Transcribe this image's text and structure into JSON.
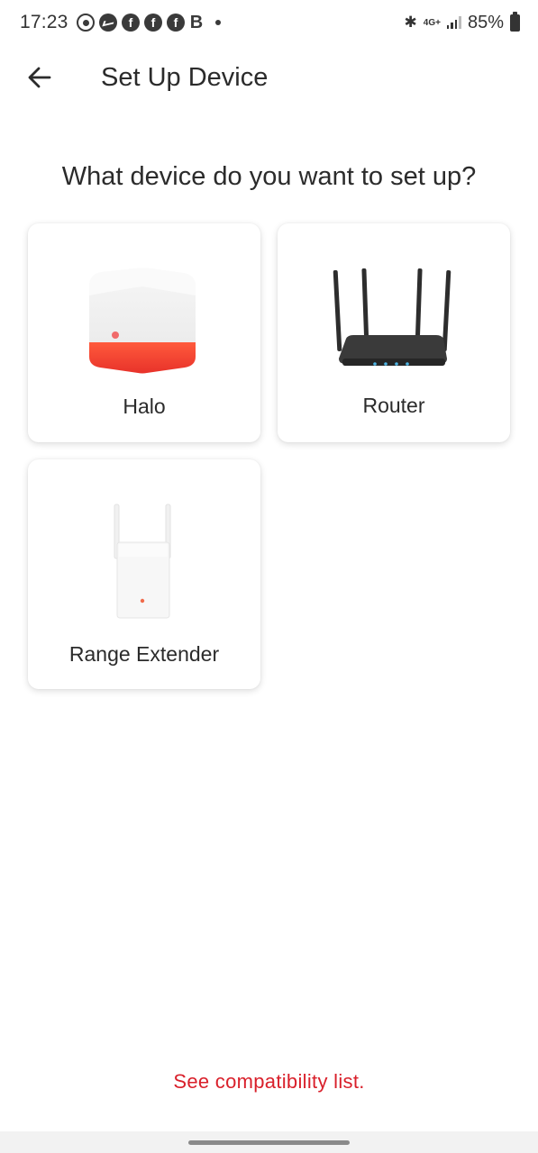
{
  "status_bar": {
    "time": "17:23",
    "notification_icons": [
      "whatsapp-icon",
      "messenger-icon",
      "facebook-icon",
      "facebook-icon",
      "facebook-icon",
      "b-icon",
      "dot-icon"
    ],
    "b_letter": "B",
    "bluetooth_glyph": "✱",
    "network": "4G+",
    "battery": "85%"
  },
  "header": {
    "title": "Set Up Device",
    "back_icon": "back-arrow-icon"
  },
  "main": {
    "question": "What device do you want to set up?",
    "devices": [
      {
        "label": "Halo",
        "icon": "halo-device-image"
      },
      {
        "label": "Router",
        "icon": "router-device-image"
      },
      {
        "label": "Range Extender",
        "icon": "range-extender-device-image"
      }
    ]
  },
  "footer": {
    "link": "See compatibility list."
  },
  "colors": {
    "accent": "#d9202b",
    "halo_band": "#ef3b2c",
    "text": "#2b2b2b"
  }
}
